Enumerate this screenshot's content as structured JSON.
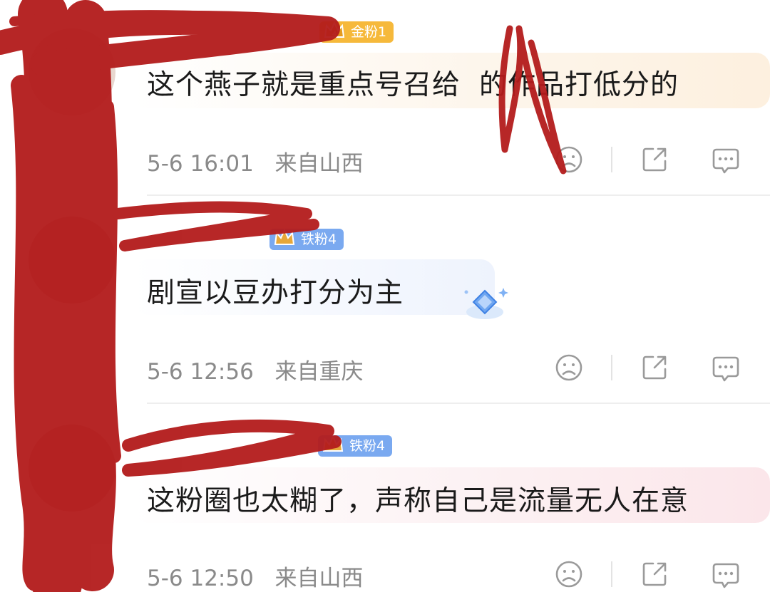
{
  "comments": [
    {
      "user_name": "",
      "badge": "金粉1",
      "text": "这个燕子就是重点号召给",
      "text_tail": "的作品打低分的",
      "date": "5-6 16:01",
      "location": "来自山西"
    },
    {
      "user_name": "",
      "badge": "铁粉4",
      "text": "剧宣以豆办打分为主",
      "date": "5-6 12:56",
      "location": "来自重庆"
    },
    {
      "user_name": "",
      "badge": "铁粉4",
      "text": "这粉圈也太糊了，声称自己是流量无人在意",
      "date": "5-6 12:50",
      "location": "来自山西"
    }
  ],
  "colors": {
    "redaction": "#b31b1b",
    "badge_gold": "#f6b93b",
    "badge_iron": "#7aa9f0",
    "meta_text": "#8a8a8a"
  },
  "icons": [
    "dislike-face-icon",
    "share-icon",
    "comment-icon"
  ]
}
